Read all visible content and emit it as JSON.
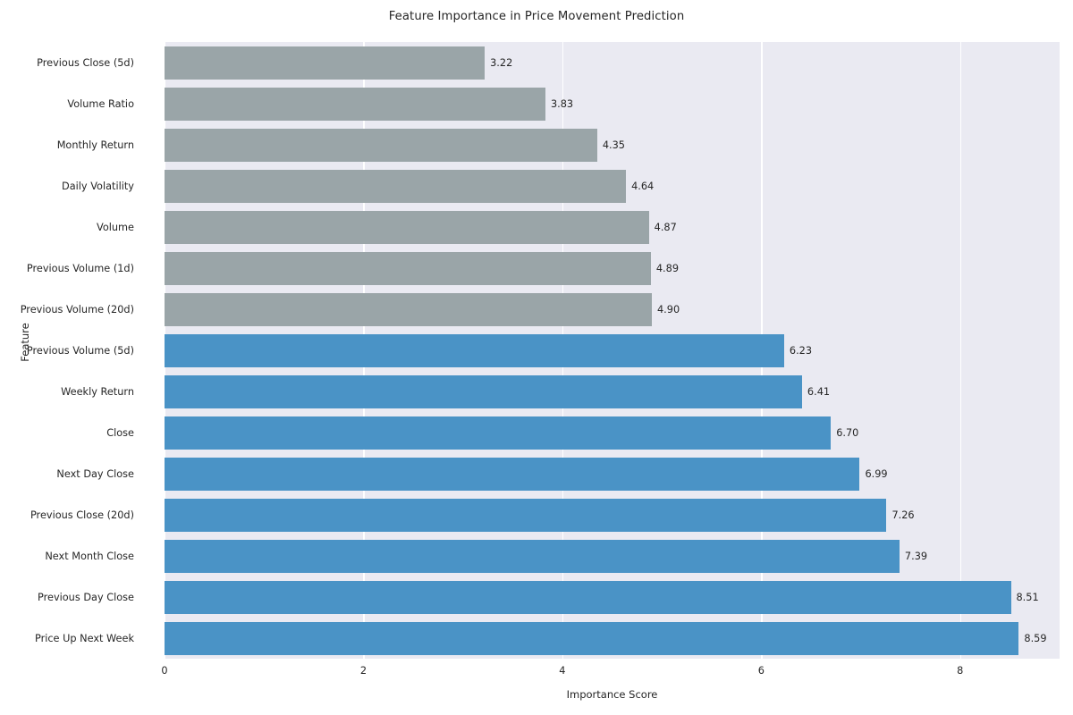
{
  "chart_data": {
    "type": "bar",
    "orientation": "horizontal",
    "title": "Feature Importance in Price Movement Prediction",
    "xlabel": "Importance Score",
    "ylabel": "Feature",
    "xlim": [
      0,
      9.0
    ],
    "xticks": [
      0,
      2,
      4,
      6,
      8
    ],
    "xtick_labels": [
      "0",
      "2",
      "4",
      "6",
      "8"
    ],
    "grid": "vertical-only",
    "legend": "none",
    "categories": [
      "Previous Close (5d)",
      "Volume Ratio",
      "Monthly Return",
      "Daily Volatility",
      "Volume",
      "Previous Volume (1d)",
      "Previous Volume (20d)",
      "Previous Volume (5d)",
      "Weekly Return",
      "Close",
      "Next Day Close",
      "Previous Close (20d)",
      "Next Month Close",
      "Previous Day Close",
      "Price Up Next Week"
    ],
    "values": [
      3.22,
      3.83,
      4.35,
      4.64,
      4.87,
      4.89,
      4.9,
      6.23,
      6.41,
      6.7,
      6.99,
      7.26,
      7.39,
      8.51,
      8.59
    ],
    "value_labels": [
      "3.22",
      "3.83",
      "4.35",
      "4.64",
      "4.87",
      "4.89",
      "4.90",
      "6.23",
      "6.41",
      "6.70",
      "6.99",
      "7.26",
      "7.39",
      "8.51",
      "8.59"
    ],
    "bar_colors": [
      "#9aa5a8",
      "#9aa5a8",
      "#9aa5a8",
      "#9aa5a8",
      "#9aa5a8",
      "#9aa5a8",
      "#9aa5a8",
      "#4a93c6",
      "#4a93c6",
      "#4a93c6",
      "#4a93c6",
      "#4a93c6",
      "#4a93c6",
      "#4a93c6",
      "#4a93c6"
    ]
  },
  "style": {
    "plot_background": "#eaeaf2",
    "figure_background": "#ffffff",
    "grid_color": "#ffffff",
    "text_color": "#262626",
    "gray_bar_color": "#9aa5a8",
    "blue_bar_color": "#4a93c6"
  }
}
